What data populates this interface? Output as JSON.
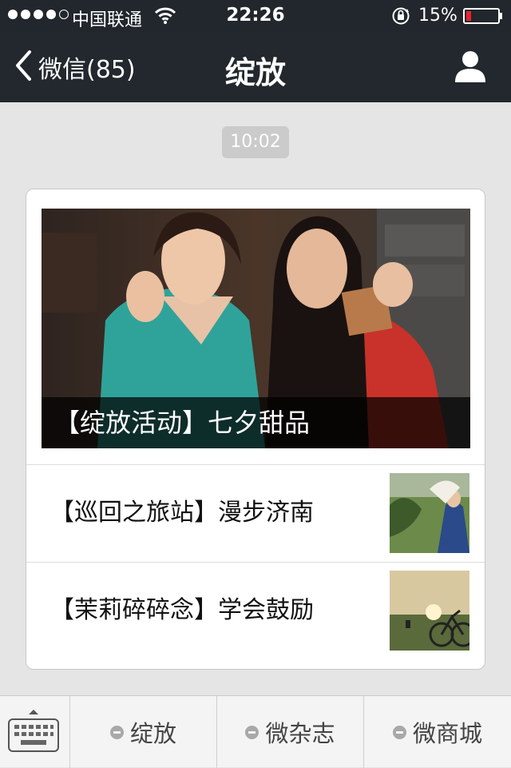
{
  "status_bar": {
    "signal_dots_filled": 4,
    "signal_dots_total": 5,
    "carrier": "中国联通",
    "wifi_icon": "wifi-icon",
    "time": "22:26",
    "orientation_lock_icon": "orientation-lock-icon",
    "battery_text": "15%",
    "battery_level": 0.15,
    "battery_color": "#e8232e"
  },
  "nav_bar": {
    "back_label": "微信(85)",
    "title": "绽放",
    "profile_icon": "person-icon"
  },
  "chat": {
    "timestamp": "10:02",
    "cover": {
      "caption": "【绽放活动】七夕甜品"
    },
    "articles": [
      {
        "title": "【巡回之旅站】漫步济南"
      },
      {
        "title": "【茉莉碎碎念】学会鼓励"
      }
    ]
  },
  "menu_bar": {
    "keyboard_icon": "keyboard-icon",
    "items": [
      {
        "label": "绽放"
      },
      {
        "label": "微杂志"
      },
      {
        "label": "微商城"
      }
    ]
  },
  "colors": {
    "nav_background": "#22282d",
    "page_background": "#e5e5e5",
    "timestamp_background": "#cbcbcb"
  }
}
